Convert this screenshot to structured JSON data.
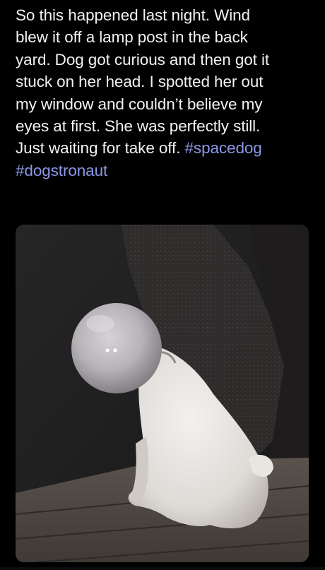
{
  "tweet": {
    "lines": [
      "So this happened last night. Wind",
      "blew it off a lamp post in the back",
      "yard. Dog got curious and then got it",
      "stuck on her head. I spotted her out",
      "my window and couldn’t believe my",
      "eyes at first. She was perfectly still.",
      "Just waiting for take off. "
    ],
    "hashtags": [
      "#spacedog",
      "#dogstronaut"
    ]
  },
  "colors": {
    "background": "#000000",
    "text": "#f2f2f2",
    "hashtag": "#8a98e6"
  },
  "media": {
    "subject": "white dog sitting on a wooden deck at night with a round glass lamp globe stuck on its head"
  }
}
